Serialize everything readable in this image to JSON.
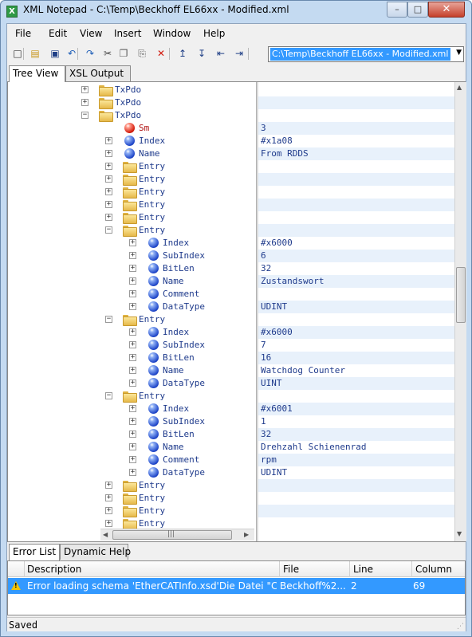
{
  "window": {
    "title": "XML Notepad - C:\\Temp\\Beckhoff EL66xx - Modified.xml",
    "app_icon": "X",
    "caption_buttons": {
      "minimize": "–",
      "maximize": "□",
      "close": "✕"
    }
  },
  "menu": {
    "items": [
      "File",
      "Edit",
      "View",
      "Insert",
      "Window",
      "Help"
    ]
  },
  "toolbar": {
    "icons": [
      "new-icon",
      "open-icon",
      "save-icon",
      "undo-icon",
      "redo-icon",
      "cut-icon",
      "copy-icon",
      "paste-icon",
      "delete-icon",
      "nudge-up-icon",
      "nudge-down-icon",
      "nudge-left-icon",
      "nudge-right-icon"
    ],
    "glyphs": [
      "□",
      "▤",
      "▣",
      "↶",
      "↷",
      "✂",
      "❐",
      "⎘",
      "✕",
      "↥",
      "↧",
      "⇤",
      "⇥"
    ],
    "path": "C:\\Temp\\Beckhoff EL66xx - Modified.xml"
  },
  "tabs_top": [
    "Tree View",
    "XSL Output"
  ],
  "tree": {
    "rows": [
      {
        "name": "TxPdo",
        "value": "",
        "icon": "folder",
        "expander": "+"
      },
      {
        "name": "TxPdo",
        "value": "",
        "icon": "folder",
        "expander": "+"
      },
      {
        "name": "TxPdo",
        "value": "",
        "icon": "folder",
        "expander": "−"
      },
      {
        "name": "Sm",
        "value": "3",
        "icon": "red-ball",
        "expander": ""
      },
      {
        "name": "Index",
        "value": "#x1a08",
        "icon": "blue-ball",
        "expander": "+"
      },
      {
        "name": "Name",
        "value": "From RDDS",
        "icon": "blue-ball",
        "expander": "+"
      },
      {
        "name": "Entry",
        "value": "",
        "icon": "folder",
        "expander": "+"
      },
      {
        "name": "Entry",
        "value": "",
        "icon": "folder",
        "expander": "+"
      },
      {
        "name": "Entry",
        "value": "",
        "icon": "folder",
        "expander": "+"
      },
      {
        "name": "Entry",
        "value": "",
        "icon": "folder",
        "expander": "+"
      },
      {
        "name": "Entry",
        "value": "",
        "icon": "folder",
        "expander": "+"
      },
      {
        "name": "Entry",
        "value": "",
        "icon": "folder",
        "expander": "−"
      },
      {
        "name": "Index",
        "value": "#x6000",
        "icon": "blue-ball",
        "expander": "+"
      },
      {
        "name": "SubIndex",
        "value": "6",
        "icon": "blue-ball",
        "expander": "+"
      },
      {
        "name": "BitLen",
        "value": "32",
        "icon": "blue-ball",
        "expander": "+"
      },
      {
        "name": "Name",
        "value": "Zustandswort",
        "icon": "blue-ball",
        "expander": "+"
      },
      {
        "name": "Comment",
        "value": "",
        "icon": "blue-ball",
        "expander": "+"
      },
      {
        "name": "DataType",
        "value": "UDINT",
        "icon": "blue-ball",
        "expander": "+"
      },
      {
        "name": "Entry",
        "value": "",
        "icon": "folder",
        "expander": "−"
      },
      {
        "name": "Index",
        "value": "#x6000",
        "icon": "blue-ball",
        "expander": "+"
      },
      {
        "name": "SubIndex",
        "value": "7",
        "icon": "blue-ball",
        "expander": "+"
      },
      {
        "name": "BitLen",
        "value": "16",
        "icon": "blue-ball",
        "expander": "+"
      },
      {
        "name": "Name",
        "value": "Watchdog Counter",
        "icon": "blue-ball",
        "expander": "+"
      },
      {
        "name": "DataType",
        "value": "UINT",
        "icon": "blue-ball",
        "expander": "+"
      },
      {
        "name": "Entry",
        "value": "",
        "icon": "folder",
        "expander": "−"
      },
      {
        "name": "Index",
        "value": "#x6001",
        "icon": "blue-ball",
        "expander": "+"
      },
      {
        "name": "SubIndex",
        "value": "1",
        "icon": "blue-ball",
        "expander": "+"
      },
      {
        "name": "BitLen",
        "value": "32",
        "icon": "blue-ball",
        "expander": "+"
      },
      {
        "name": "Name",
        "value": "Drehzahl Schienenrad",
        "icon": "blue-ball",
        "expander": "+"
      },
      {
        "name": "Comment",
        "value": "rpm",
        "icon": "blue-ball",
        "expander": "+"
      },
      {
        "name": "DataType",
        "value": "UDINT",
        "icon": "blue-ball",
        "expander": "+"
      },
      {
        "name": "Entry",
        "value": "",
        "icon": "folder",
        "expander": "+"
      },
      {
        "name": "Entry",
        "value": "",
        "icon": "folder",
        "expander": "+"
      },
      {
        "name": "Entry",
        "value": "",
        "icon": "folder",
        "expander": "+"
      },
      {
        "name": "Entry",
        "value": "",
        "icon": "folder",
        "expander": "+"
      }
    ]
  },
  "tabs_bottom": [
    "Error List",
    "Dynamic Help"
  ],
  "error_list": {
    "columns": [
      "Description",
      "File",
      "Line",
      "Column"
    ],
    "rows": [
      {
        "description": "Error loading schema 'EtherCATInfo.xsd'Die Datei \"C:\\T...",
        "file": "Beckhoff%2...",
        "line": "2",
        "column": "69",
        "icon": "warning-icon"
      }
    ]
  },
  "status": {
    "text": "Saved"
  }
}
